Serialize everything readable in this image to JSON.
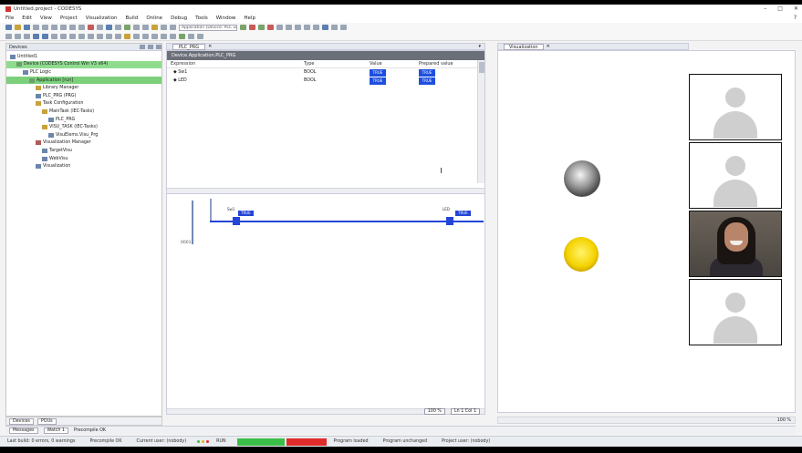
{
  "window": {
    "title": "Untitled.project - CODESYS",
    "controls": [
      "–",
      "□",
      "✕"
    ]
  },
  "menu": [
    "File",
    "Edit",
    "View",
    "Project",
    "Visualization",
    "Build",
    "Online",
    "Debug",
    "Tools",
    "Window",
    "Help"
  ],
  "toolbar": {
    "application_select": "Application [Device: PLC Logic]"
  },
  "devices_pane": {
    "title": "Devices",
    "tree": [
      {
        "label": "Untitled1",
        "indent": 0,
        "icon": "project-icon",
        "state": ""
      },
      {
        "label": "Device (CODESYS Control Win V3 x64)",
        "indent": 1,
        "icon": "device-icon",
        "state": "selected-device"
      },
      {
        "label": "PLC Logic",
        "indent": 2,
        "icon": "plc-logic-icon",
        "state": ""
      },
      {
        "label": "Application [run]",
        "indent": 3,
        "icon": "application-icon",
        "state": "selected"
      },
      {
        "label": "Library Manager",
        "indent": 4,
        "icon": "library-icon",
        "state": ""
      },
      {
        "label": "PLC_PRG (PRG)",
        "indent": 4,
        "icon": "pou-icon",
        "state": ""
      },
      {
        "label": "Task Configuration",
        "indent": 4,
        "icon": "task-config-icon",
        "state": ""
      },
      {
        "label": "MainTask (IEC-Tasks)",
        "indent": 5,
        "icon": "task-icon",
        "state": ""
      },
      {
        "label": "PLC_PRG",
        "indent": 6,
        "icon": "call-icon",
        "state": ""
      },
      {
        "label": "VISU_TASK (IEC-Tasks)",
        "indent": 5,
        "icon": "task-icon",
        "state": ""
      },
      {
        "label": "VisuElems.Visu_Prg",
        "indent": 6,
        "icon": "call-icon",
        "state": ""
      },
      {
        "label": "Visualization Manager",
        "indent": 4,
        "icon": "visu-manager-icon",
        "state": ""
      },
      {
        "label": "TargetVisu",
        "indent": 5,
        "icon": "target-visu-icon",
        "state": ""
      },
      {
        "label": "WebVisu",
        "indent": 5,
        "icon": "webvisu-icon",
        "state": ""
      },
      {
        "label": "Visualization",
        "indent": 4,
        "icon": "visualization-icon",
        "state": ""
      }
    ],
    "bottom_tabs": [
      "Devices",
      "POUs"
    ]
  },
  "editor": {
    "tab_label": "PLC_PRG",
    "var_panel_title": "Device.Application.PLC_PRG",
    "columns": [
      "Expression",
      "Type",
      "Value",
      "Prepared value"
    ],
    "rows": [
      {
        "expression": "Sw1",
        "type": "BOOL",
        "value": "TRUE",
        "prepared": "TRUE"
      },
      {
        "expression": "LED",
        "type": "BOOL",
        "value": "TRUE",
        "prepared": "TRUE"
      }
    ],
    "rung_number": "0001",
    "contacts": [
      {
        "tag": "Sw1",
        "value": "TRUE"
      },
      {
        "tag": "LED",
        "value": "TRUE"
      }
    ],
    "footer": {
      "zoom_btn": "100 %",
      "pos_btn": "Ln 1 Col 1"
    }
  },
  "visualization": {
    "tab_label": "Visualization",
    "footer": "100 %"
  },
  "messages_bar": {
    "items": [
      "Messages",
      "Watch 1",
      "Precompile OK"
    ]
  },
  "status_bar": {
    "items": [
      "Last build: 0 errors, 0 warnings",
      "Precompile OK",
      "Current user: (nobody)",
      "RUN",
      "Program loaded",
      "Program unchanged",
      "Project user: (nobody)"
    ]
  },
  "meeting": {
    "tiles": [
      "avatar",
      "avatar",
      "camera",
      "avatar"
    ]
  },
  "colors": {
    "selected_green": "#7cd07c",
    "value_blue": "#1f4fe0",
    "rung_blue": "#2445d6",
    "lamp_yellow": "#f4d200",
    "status_green": "#3cbf4a",
    "status_red": "#e02b2b"
  }
}
